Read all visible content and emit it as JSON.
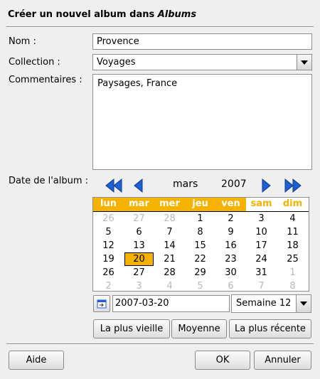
{
  "dialog": {
    "title_prefix": "Créer un nouvel album dans ",
    "title_target": "Albums"
  },
  "form": {
    "name_label": "Nom :",
    "name_value": "Provence",
    "collection_label": "Collection :",
    "collection_value": "Voyages",
    "comments_label": "Commentaires :",
    "comments_value": "Paysages, France",
    "date_label": "Date de l'album :"
  },
  "calendar": {
    "month": "mars",
    "year": "2007",
    "weekdays": [
      "lun",
      "mar",
      "mer",
      "jeu",
      "ven",
      "sam",
      "dim"
    ],
    "weeks": [
      [
        {
          "d": "26",
          "dim": true
        },
        {
          "d": "27",
          "dim": true
        },
        {
          "d": "28",
          "dim": true
        },
        {
          "d": "1"
        },
        {
          "d": "2"
        },
        {
          "d": "3"
        },
        {
          "d": "4"
        }
      ],
      [
        {
          "d": "5"
        },
        {
          "d": "6"
        },
        {
          "d": "7"
        },
        {
          "d": "8"
        },
        {
          "d": "9"
        },
        {
          "d": "10"
        },
        {
          "d": "11"
        }
      ],
      [
        {
          "d": "12"
        },
        {
          "d": "13"
        },
        {
          "d": "14"
        },
        {
          "d": "15"
        },
        {
          "d": "16"
        },
        {
          "d": "17"
        },
        {
          "d": "18"
        }
      ],
      [
        {
          "d": "19"
        },
        {
          "d": "20",
          "sel": true
        },
        {
          "d": "21"
        },
        {
          "d": "22"
        },
        {
          "d": "23"
        },
        {
          "d": "24"
        },
        {
          "d": "25"
        }
      ],
      [
        {
          "d": "26"
        },
        {
          "d": "27"
        },
        {
          "d": "28"
        },
        {
          "d": "29"
        },
        {
          "d": "30"
        },
        {
          "d": "31"
        },
        {
          "d": "1",
          "dim": true
        }
      ],
      [
        {
          "d": "2",
          "dim": true
        },
        {
          "d": "3",
          "dim": true
        },
        {
          "d": "4",
          "dim": true
        },
        {
          "d": "5",
          "dim": true
        },
        {
          "d": "6",
          "dim": true
        },
        {
          "d": "7",
          "dim": true
        },
        {
          "d": "8",
          "dim": true
        }
      ]
    ],
    "date_value": "2007-03-20",
    "week_value": "Semaine 12",
    "header_color": "#f6b200",
    "arrow_color": "#1f5fd6"
  },
  "buttons": {
    "oldest": "La plus vieille",
    "average": "Moyenne",
    "newest": "La plus récente",
    "help": "Aide",
    "ok": "OK",
    "cancel": "Annuler"
  }
}
